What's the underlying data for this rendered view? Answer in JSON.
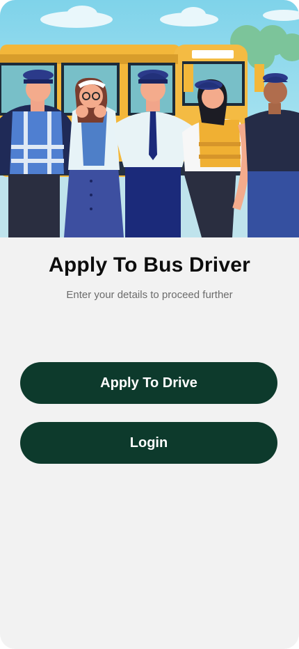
{
  "screen": {
    "title": "Apply To Bus Driver",
    "subtitle": "Enter your details to proceed further"
  },
  "actions": {
    "apply_label": "Apply To Drive",
    "login_label": "Login"
  },
  "hero": {
    "description_icon": "bus-drivers-illustration"
  },
  "colors": {
    "background": "#f2f2f2",
    "button": "#0d3a2c",
    "button_text": "#ffffff",
    "title": "#0d0d0d",
    "subtitle": "#6b6b6b",
    "bus": "#f3b73a",
    "sky": "#7ccfe6"
  }
}
